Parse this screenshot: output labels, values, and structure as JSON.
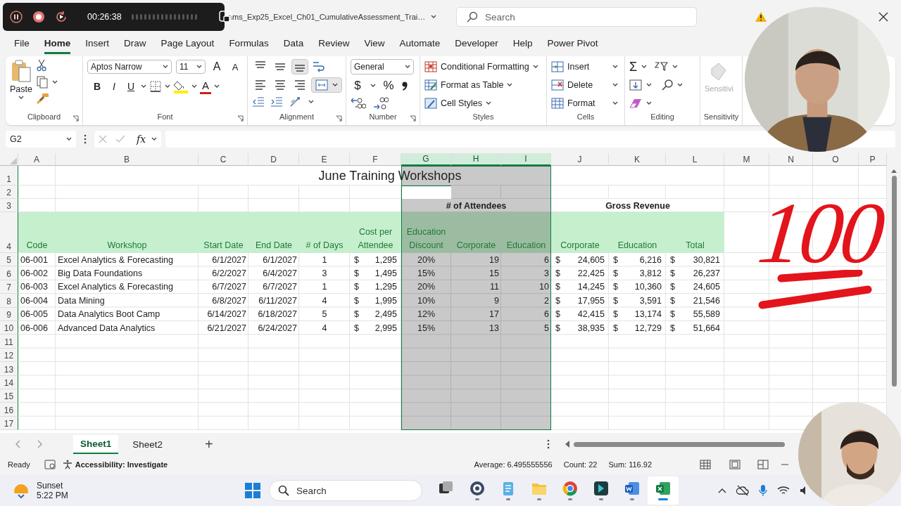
{
  "recorder": {
    "time": "00:26:38"
  },
  "titlebar": {
    "document_title": "ams_Exp25_Excel_Ch01_CumulativeAssessment_Trai…",
    "search_placeholder": "Search"
  },
  "menu_tabs": [
    {
      "label": "File",
      "selected": false
    },
    {
      "label": "Home",
      "selected": true
    },
    {
      "label": "Insert",
      "selected": false
    },
    {
      "label": "Draw",
      "selected": false
    },
    {
      "label": "Page Layout",
      "selected": false
    },
    {
      "label": "Formulas",
      "selected": false
    },
    {
      "label": "Data",
      "selected": false
    },
    {
      "label": "Review",
      "selected": false
    },
    {
      "label": "View",
      "selected": false
    },
    {
      "label": "Automate",
      "selected": false
    },
    {
      "label": "Developer",
      "selected": false
    },
    {
      "label": "Help",
      "selected": false
    },
    {
      "label": "Power Pivot",
      "selected": false
    }
  ],
  "ribbon": {
    "clipboard": {
      "label": "Clipboard",
      "paste": "Paste"
    },
    "font": {
      "label": "Font",
      "font_name": "Aptos Narrow",
      "font_size": "11",
      "size_buttons": [
        "A",
        "A"
      ],
      "style_buttons": [
        "B",
        "I",
        "U"
      ],
      "color_button": "A"
    },
    "alignment": {
      "label": "Alignment",
      "vertical_align": [
        {
          "selected": false
        },
        {
          "selected": false
        },
        {
          "selected": true
        }
      ],
      "horizontal_align": [
        {
          "selected": false
        },
        {
          "selected": false
        },
        {
          "selected": false
        }
      ],
      "merge": {
        "selected": true
      }
    },
    "number": {
      "label": "Number",
      "format": "General",
      "symbols": [
        "$",
        "%"
      ]
    },
    "styles": {
      "label": "Styles",
      "commands": [
        "Conditional Formatting",
        "Format as Table",
        "Cell Styles"
      ]
    },
    "cells": {
      "label": "Cells",
      "commands": [
        "Insert",
        "Delete",
        "Format"
      ]
    },
    "editing": {
      "label": "Editing",
      "autosum": "Σ"
    },
    "sensitivity": {
      "label": "Sensitivity",
      "button": "Sensitivi",
      "disabled": true
    }
  },
  "formula_bar": {
    "name_box": "G2",
    "fx": "fx"
  },
  "sheet": {
    "columns": [
      {
        "label": "A",
        "selected": false
      },
      {
        "label": "B",
        "selected": false
      },
      {
        "label": "C",
        "selected": false
      },
      {
        "label": "D",
        "selected": false
      },
      {
        "label": "E",
        "selected": false
      },
      {
        "label": "F",
        "selected": false
      },
      {
        "label": "G",
        "selected": true
      },
      {
        "label": "H",
        "selected": true
      },
      {
        "label": "I",
        "selected": true
      },
      {
        "label": "J",
        "selected": false
      },
      {
        "label": "K",
        "selected": false
      },
      {
        "label": "L",
        "selected": false
      },
      {
        "label": "M",
        "selected": false
      },
      {
        "label": "N",
        "selected": false
      },
      {
        "label": "O",
        "selected": false
      },
      {
        "label": "P",
        "selected": false
      }
    ],
    "row_numbers": [
      "1",
      "2",
      "3",
      "4",
      "5",
      "6",
      "7",
      "8",
      "9",
      "10",
      "11",
      "12",
      "13",
      "14",
      "15",
      "16",
      "17"
    ],
    "title": "June Training Workshops",
    "group_headings": [
      "# of Attendees",
      "Gross Revenue"
    ],
    "header_row": [
      "Code",
      "Workshop",
      "Start Date",
      "End Date",
      "# of Days",
      "Cost per Attendee",
      "Education Discount",
      "Corporate",
      "Education",
      "Corporate",
      "Education",
      "Total"
    ],
    "rows": [
      {
        "cells": [
          "06-001",
          "Excel Analytics & Forecasting",
          "6/1/2027",
          "6/1/2027",
          "1",
          [
            "$",
            "1,295"
          ],
          "20%",
          "19",
          "6",
          [
            "$",
            "24,605"
          ],
          [
            "$",
            "6,216"
          ],
          [
            "$",
            "30,821"
          ]
        ]
      },
      {
        "cells": [
          "06-002",
          "Big Data Foundations",
          "6/2/2027",
          "6/4/2027",
          "3",
          [
            "$",
            "1,495"
          ],
          "15%",
          "15",
          "3",
          [
            "$",
            "22,425"
          ],
          [
            "$",
            "3,812"
          ],
          [
            "$",
            "26,237"
          ]
        ]
      },
      {
        "cells": [
          "06-003",
          "Excel Analytics & Forecasting",
          "6/7/2027",
          "6/7/2027",
          "1",
          [
            "$",
            "1,295"
          ],
          "20%",
          "11",
          "10",
          [
            "$",
            "14,245"
          ],
          [
            "$",
            "10,360"
          ],
          [
            "$",
            "24,605"
          ]
        ]
      },
      {
        "cells": [
          "06-004",
          "Data Mining",
          "6/8/2027",
          "6/11/2027",
          "4",
          [
            "$",
            "1,995"
          ],
          "10%",
          "9",
          "2",
          [
            "$",
            "17,955"
          ],
          [
            "$",
            "3,591"
          ],
          [
            "$",
            "21,546"
          ]
        ]
      },
      {
        "cells": [
          "06-005",
          "Data Analytics Boot Camp",
          "6/14/2027",
          "6/18/2027",
          "5",
          [
            "$",
            "2,495"
          ],
          "12%",
          "17",
          "6",
          [
            "$",
            "42,415"
          ],
          [
            "$",
            "13,174"
          ],
          [
            "$",
            "55,589"
          ]
        ]
      },
      {
        "cells": [
          "06-006",
          "Advanced Data Analytics",
          "6/21/2027",
          "6/24/2027",
          "4",
          [
            "$",
            "2,995"
          ],
          "15%",
          "13",
          "5",
          [
            "$",
            "38,935"
          ],
          [
            "$",
            "12,729"
          ],
          [
            "$",
            "51,664"
          ]
        ]
      }
    ]
  },
  "sticker": {
    "text": "100"
  },
  "sheet_tabs": [
    {
      "label": "Sheet1",
      "selected": true
    },
    {
      "label": "Sheet2",
      "selected": false
    }
  ],
  "add_sheet": "+",
  "status_bar": {
    "mode": "Ready",
    "accessibility": "Accessibility: Investigate",
    "stats": [
      "Average: 6.495555556",
      "Count: 22",
      "Sum: 116.92"
    ]
  },
  "taskbar": {
    "weather": "Sunset",
    "time": "5:22 PM",
    "search_placeholder": "Search",
    "apps": [
      {
        "running": false
      },
      {
        "running": true
      },
      {
        "running": true
      },
      {
        "running": true
      },
      {
        "running": true
      },
      {
        "running": true
      },
      {
        "running": true
      },
      {
        "running": true,
        "selected": true
      }
    ]
  }
}
